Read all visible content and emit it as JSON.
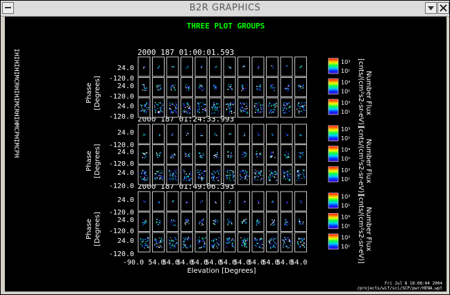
{
  "window": {
    "title": "B2R GRAPHICS",
    "buttons": [
      "menu-icon",
      "minimize-icon",
      "close-icon"
    ]
  },
  "plot": {
    "title": "THREE PLOT GROUPS",
    "title_color": "#00ff00",
    "timestamps": [
      "2000 187 01:00:01.593",
      "2000 187 01:24:33.993",
      "2000 187 01:49:06.393"
    ],
    "ylabel_line1": "Phase",
    "ylabel_line2": "[Degrees]",
    "ytick_top": "24.0",
    "ytick_mid": "-120.0",
    "ytick_bottom": "-120.0",
    "colorbar_label_line1": "Number Flux",
    "colorbar_label_line2": "[cnts/(cm²s2-sr-eV)]",
    "colorbar_labels_top": [
      "10³",
      "10¹"
    ],
    "colorbar_labels_mid": [
      "10³",
      "10¹"
    ],
    "colorbar_labels_bot": [
      "10³",
      "10¹"
    ],
    "xtick_labels": [
      "-90.0",
      "54.0",
      "54.0",
      "54.0",
      "54.0",
      "54.0",
      "54.0",
      "54.0",
      "54.0",
      "54.0",
      "54.0",
      "54.0"
    ],
    "xlabel": "Elevation  [Degrees]",
    "left_sidebar_text": "IHIHIHIMCRHIHIMCRHIHMCPHIMCPH",
    "footer_line1": "Fri Jul  8 18:08:04 2004",
    "footer_line2": "/projects/wif/sci/SCP/pwr/HENA.wpt",
    "grid": {
      "groups": 3,
      "rows_per_group": 3,
      "columns": 12
    }
  }
}
